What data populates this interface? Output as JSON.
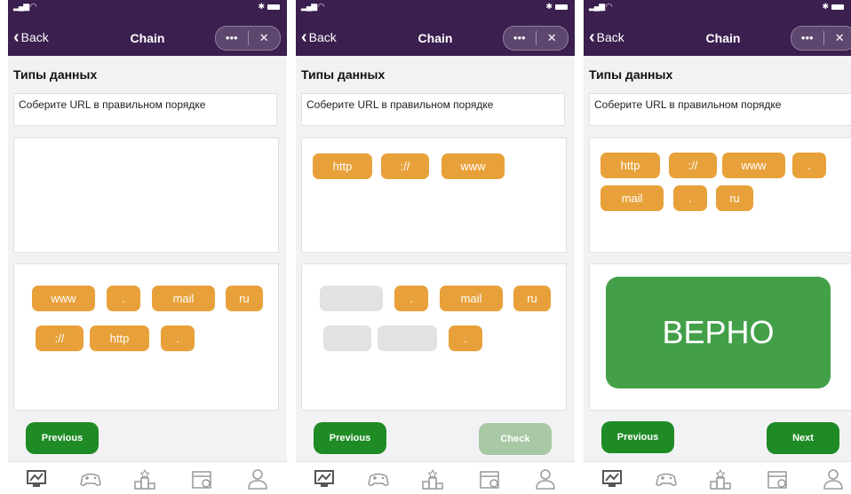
{
  "app": {
    "back_label": "Back",
    "title": "Chain",
    "more_icon": "more-dots-icon",
    "close_icon": "close-icon"
  },
  "lesson": {
    "heading": "Типы данных",
    "instruction": "Соберите URL в правильном порядке"
  },
  "colors": {
    "header": "#3a1f4f",
    "chip": "#e8a13a",
    "button_green": "#1f8b25",
    "button_disabled": "#a9c8a6",
    "result_green": "#43a049"
  },
  "screens": [
    {
      "answer_chips": [],
      "source_chips": [
        "www",
        ".",
        "mail",
        "ru",
        "://",
        "http",
        "."
      ],
      "buttons": {
        "previous": "Previous"
      }
    },
    {
      "answer_chips": [
        "http",
        "://",
        "www"
      ],
      "source_chips": [
        ".",
        "mail",
        "ru",
        "."
      ],
      "buttons": {
        "previous": "Previous",
        "check": "Check"
      }
    },
    {
      "answer_chips": [
        "http",
        "://",
        "www",
        ".",
        "mail",
        ".",
        "ru"
      ],
      "result": "ВЕРНО",
      "buttons": {
        "previous": "Previous",
        "next": "Next"
      }
    }
  ],
  "tabbar": [
    "dashboard-icon",
    "gamepad-icon",
    "leaderboard-icon",
    "calendar-icon",
    "profile-icon"
  ]
}
